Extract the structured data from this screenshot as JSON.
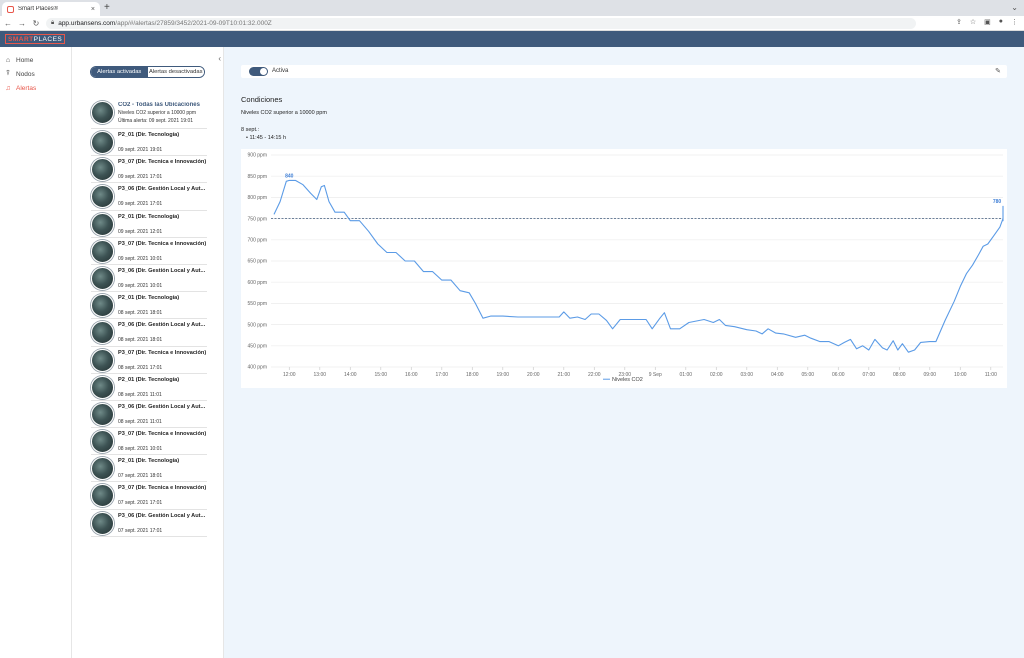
{
  "browser": {
    "tab_title": "Smart Places®",
    "url_host": "app.urbansens.com",
    "url_path": "/app/#/alertas/27859/3452/2021-09-09T10:01:32.000Z"
  },
  "app": {
    "logo_left": "SMART",
    "logo_right": "PLACES"
  },
  "nav": {
    "items": [
      {
        "label": "Home",
        "icon": "home-icon"
      },
      {
        "label": "Nodos",
        "icon": "antenna-icon"
      },
      {
        "label": "Alertas",
        "icon": "bell-icon"
      }
    ]
  },
  "alerts_panel": {
    "tab_active": "Alertas activadas",
    "tab_inactive": "Alertas desactivadas",
    "first": {
      "name": "CO2 - Todas las Ubicaciones",
      "line1": "Niveles CO2 superior a 10000 ppm",
      "line2": "Última alerta: 09 sept. 2021 19:01"
    },
    "items": [
      {
        "name": "P2_01 (Dir. Tecnología)",
        "date": "09 sept. 2021 19:01"
      },
      {
        "name": "P3_07 (Dir. Tecnica e Innovación)",
        "date": "09 sept. 2021 17:01"
      },
      {
        "name": "P3_06 (Dir. Gestión Local y Aut...",
        "date": "09 sept. 2021 17:01"
      },
      {
        "name": "P2_01 (Dir. Tecnología)",
        "date": "09 sept. 2021 12:01"
      },
      {
        "name": "P3_07 (Dir. Tecnica e Innovación)",
        "date": "09 sept. 2021 10:01"
      },
      {
        "name": "P3_06 (Dir. Gestión Local y Aut...",
        "date": "09 sept. 2021 10:01"
      },
      {
        "name": "P2_01 (Dir. Tecnología)",
        "date": "08 sept. 2021 18:01"
      },
      {
        "name": "P3_06 (Dir. Gestión Local y Aut...",
        "date": "08 sept. 2021 18:01"
      },
      {
        "name": "P3_07 (Dir. Tecnica e Innovación)",
        "date": "08 sept. 2021 17:01"
      },
      {
        "name": "P2_01 (Dir. Tecnología)",
        "date": "08 sept. 2021 11:01"
      },
      {
        "name": "P3_06 (Dir. Gestión Local y Aut...",
        "date": "08 sept. 2021 11:01"
      },
      {
        "name": "P3_07 (Dir. Tecnica e Innovación)",
        "date": "08 sept. 2021 10:01"
      },
      {
        "name": "P2_01 (Dir. Tecnología)",
        "date": "07 sept. 2021 18:01"
      },
      {
        "name": "P3_07 (Dir. Tecnica e Innovación)",
        "date": "07 sept. 2021 17:01"
      },
      {
        "name": "P3_06 (Dir. Gestión Local y Aut...",
        "date": "07 sept. 2021 17:01"
      }
    ]
  },
  "main": {
    "toggle_label": "Activa",
    "conditions_title": "Condiciones",
    "conditions_text": "Niveles CO2 superior a 10000 ppm",
    "date_label": "8 sept.:",
    "time_range": "• 11:45 - 14:15 h"
  },
  "colors": {
    "primary": "#3f5a7c",
    "accent": "#e8564a",
    "line": "#5b9be6"
  },
  "chart_data": {
    "type": "line",
    "ylim": [
      400,
      900
    ],
    "yticks": [
      "400 ppm",
      "450 ppm",
      "500 ppm",
      "550 ppm",
      "600 ppm",
      "650 ppm",
      "700 ppm",
      "750 ppm",
      "800 ppm",
      "850 ppm",
      "900 ppm"
    ],
    "xticks": [
      "12:00",
      "13:00",
      "14:00",
      "15:00",
      "16:00",
      "17:00",
      "18:00",
      "19:00",
      "20:00",
      "21:00",
      "22:00",
      "23:00",
      "9 Sep",
      "01:00",
      "02:00",
      "03:00",
      "04:00",
      "05:00",
      "06:00",
      "07:00",
      "08:00",
      "09:00",
      "10:00",
      "11:00"
    ],
    "x_range_hours": [
      11.4,
      35.4
    ],
    "threshold": 750,
    "series": [
      {
        "name": "Niveles CO2",
        "points": [
          [
            11.5,
            760
          ],
          [
            11.7,
            790
          ],
          [
            11.9,
            838
          ],
          [
            12.0,
            840
          ],
          [
            12.2,
            840
          ],
          [
            12.45,
            830
          ],
          [
            12.7,
            810
          ],
          [
            12.9,
            795
          ],
          [
            13.05,
            825
          ],
          [
            13.15,
            828
          ],
          [
            13.3,
            790
          ],
          [
            13.5,
            765
          ],
          [
            13.8,
            765
          ],
          [
            14.0,
            745
          ],
          [
            14.3,
            745
          ],
          [
            14.6,
            720
          ],
          [
            14.9,
            690
          ],
          [
            15.2,
            670
          ],
          [
            15.5,
            670
          ],
          [
            15.8,
            650
          ],
          [
            16.1,
            650
          ],
          [
            16.4,
            625
          ],
          [
            16.7,
            625
          ],
          [
            17.0,
            605
          ],
          [
            17.3,
            605
          ],
          [
            17.6,
            580
          ],
          [
            17.9,
            575
          ],
          [
            18.1,
            550
          ],
          [
            18.35,
            515
          ],
          [
            18.6,
            520
          ],
          [
            19.0,
            520
          ],
          [
            19.5,
            518
          ],
          [
            20.0,
            518
          ],
          [
            20.5,
            518
          ],
          [
            20.85,
            518
          ],
          [
            21.0,
            530
          ],
          [
            21.2,
            515
          ],
          [
            21.45,
            518
          ],
          [
            21.7,
            512
          ],
          [
            21.9,
            525
          ],
          [
            22.15,
            525
          ],
          [
            22.4,
            510
          ],
          [
            22.6,
            490
          ],
          [
            22.85,
            512
          ],
          [
            23.3,
            512
          ],
          [
            23.7,
            512
          ],
          [
            23.9,
            490
          ],
          [
            24.15,
            515
          ],
          [
            24.3,
            528
          ],
          [
            24.5,
            490
          ],
          [
            24.8,
            490
          ],
          [
            25.1,
            505
          ],
          [
            25.6,
            512
          ],
          [
            25.9,
            505
          ],
          [
            26.1,
            512
          ],
          [
            26.3,
            498
          ],
          [
            26.6,
            495
          ],
          [
            27.0,
            488
          ],
          [
            27.3,
            485
          ],
          [
            27.5,
            478
          ],
          [
            27.7,
            490
          ],
          [
            27.95,
            480
          ],
          [
            28.2,
            478
          ],
          [
            28.6,
            470
          ],
          [
            28.9,
            475
          ],
          [
            29.1,
            468
          ],
          [
            29.4,
            460
          ],
          [
            29.7,
            460
          ],
          [
            30.0,
            450
          ],
          [
            30.2,
            458
          ],
          [
            30.4,
            465
          ],
          [
            30.6,
            443
          ],
          [
            30.8,
            450
          ],
          [
            31.0,
            440
          ],
          [
            31.2,
            465
          ],
          [
            31.45,
            445
          ],
          [
            31.6,
            440
          ],
          [
            31.8,
            462
          ],
          [
            31.95,
            440
          ],
          [
            32.1,
            455
          ],
          [
            32.3,
            435
          ],
          [
            32.5,
            440
          ],
          [
            32.7,
            458
          ],
          [
            33.0,
            460
          ],
          [
            33.2,
            460
          ],
          [
            33.5,
            510
          ],
          [
            33.8,
            555
          ],
          [
            34.0,
            590
          ],
          [
            34.2,
            620
          ],
          [
            34.4,
            640
          ],
          [
            34.6,
            665
          ],
          [
            34.75,
            685
          ],
          [
            34.9,
            690
          ],
          [
            35.1,
            710
          ],
          [
            35.3,
            730
          ],
          [
            35.5,
            750
          ],
          [
            35.8,
            745
          ],
          [
            36.0,
            750
          ],
          [
            36.15,
            765
          ],
          [
            36.25,
            780
          ]
        ]
      }
    ],
    "labels": [
      {
        "x": 12.0,
        "y": 840,
        "text": "840"
      },
      {
        "x": 36.25,
        "y": 780,
        "text": "780"
      }
    ]
  }
}
